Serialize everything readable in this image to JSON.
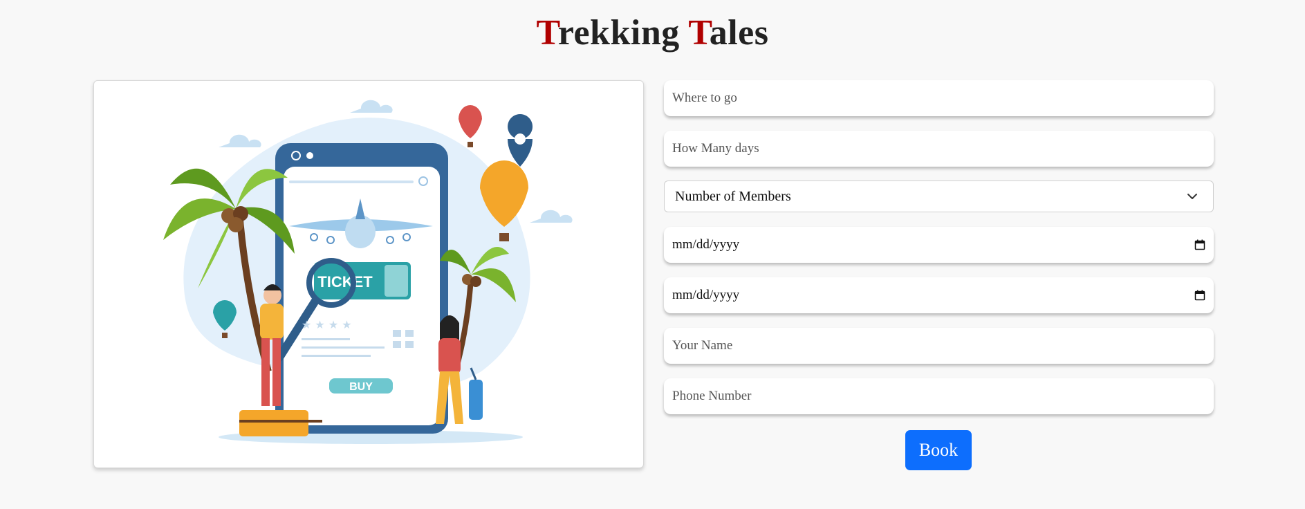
{
  "header": {
    "title_initial_1": "T",
    "title_rest_1": "rekking ",
    "title_initial_2": "T",
    "title_rest_2": "ales",
    "accent_color": "#b00000"
  },
  "illustration": {
    "ticket_text": "TICKET",
    "buy_text": "BUY"
  },
  "form": {
    "destination_placeholder": "Where to go",
    "days_placeholder": "How Many days",
    "members_selected": "Number of Members",
    "start_date_placeholder": "mm/dd/yyyy",
    "end_date_placeholder": "mm/dd/yyyy",
    "name_placeholder": "Your Name",
    "phone_placeholder": "Phone Number",
    "book_label": "Book",
    "button_color": "#0d6efd"
  }
}
